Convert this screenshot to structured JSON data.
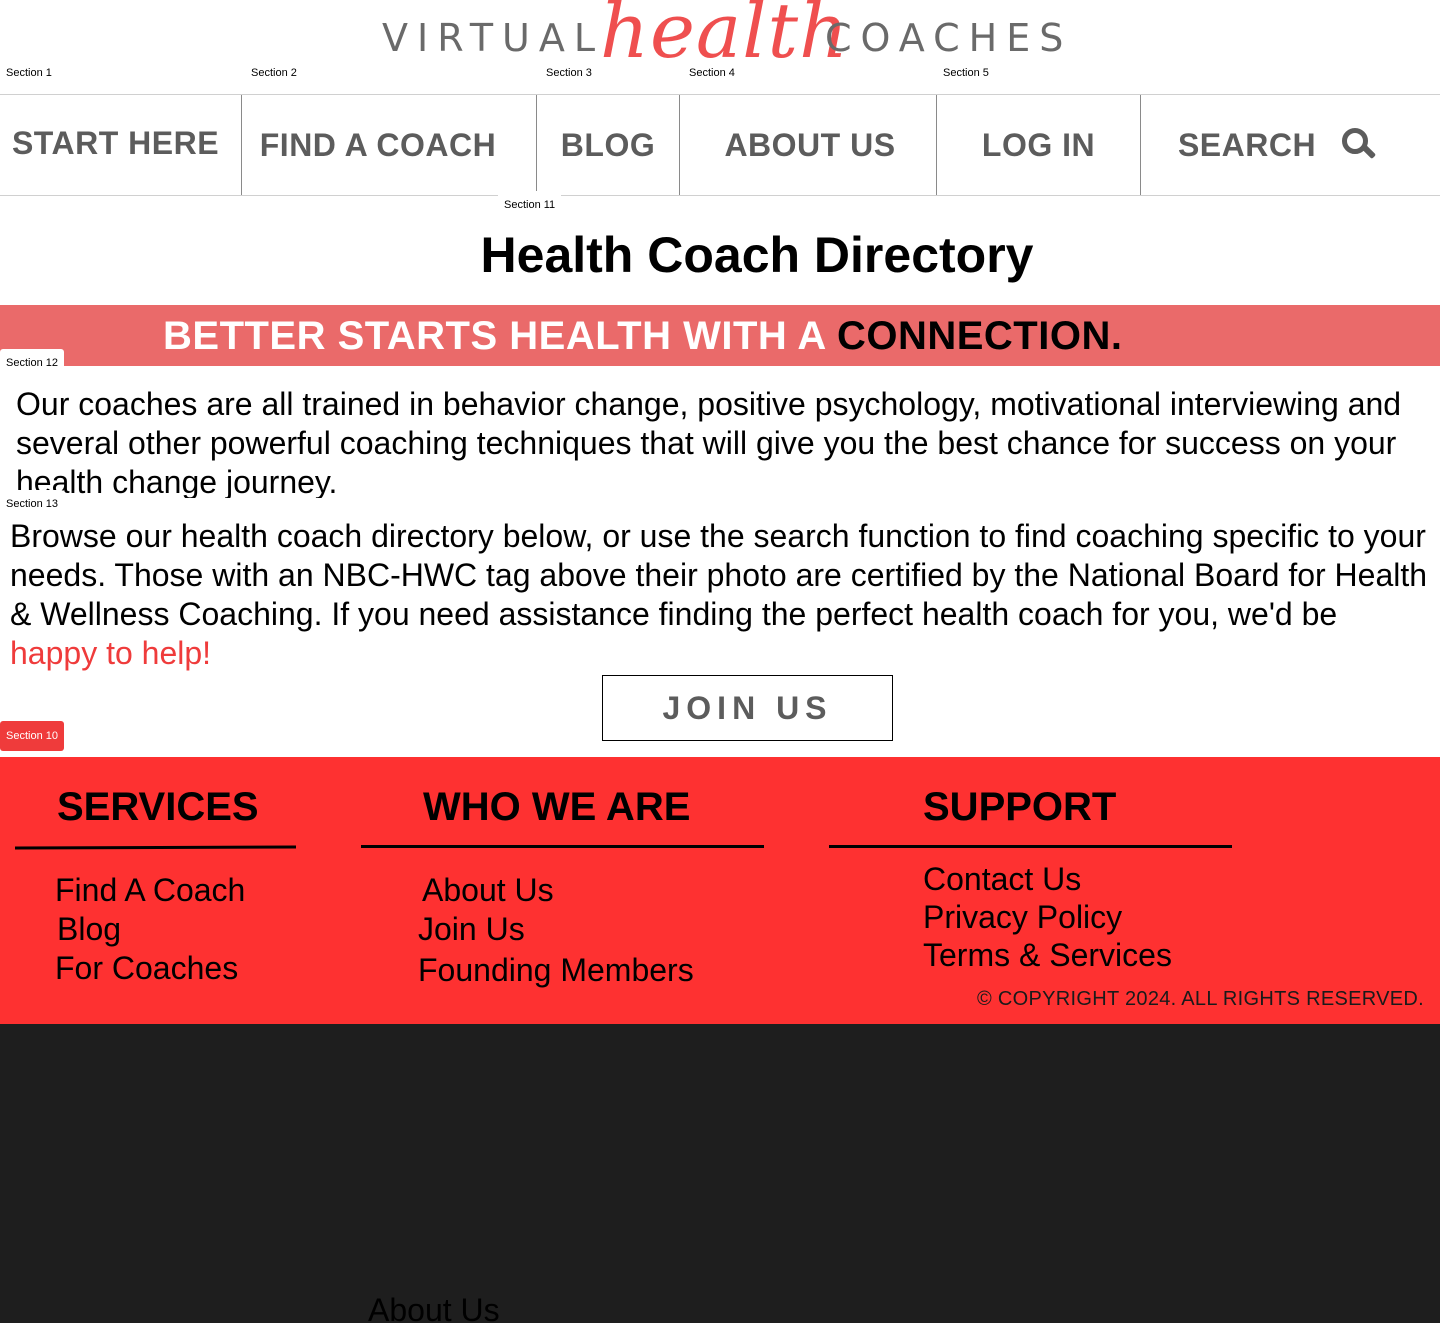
{
  "logo": {
    "left_word": "VIRTUAL",
    "script_word": "health",
    "right_word": "COACHES",
    "brand_color": "#ef4f4f"
  },
  "section_labels": {
    "s1": "Section 1",
    "s2": "Section 2",
    "s3": "Section 3",
    "s4": "Section 4",
    "s5": "Section 5",
    "s11": "Section 11",
    "s12": "Section 12",
    "s13": "Section 13",
    "s10": "Section 10"
  },
  "nav": {
    "start_here": "START HERE",
    "find_a_coach": "FIND  A COACH",
    "blog": "BLOG",
    "about_us": "ABOUT US",
    "log_in": "LOG IN",
    "search": "SEARCH",
    "search_icon": "search-icon"
  },
  "main": {
    "title": "Health Coach Directory",
    "banner_light": "BETTER STARTS HEALTH WITH A ",
    "banner_dark": "CONNECTION.",
    "banner_color": "#ea6a6a",
    "para1": "Our coaches are all trained in behavior change, positive psychology, motivational interviewing and several other powerful coaching techniques that will give you the best chance for success on your health change journey.",
    "para2": "Browse our health coach directory below, or use the search function to find coaching specific to your needs. Those with an NBC-HWC tag above their photo are certified by the National Board for Health & Wellness Coaching. If you need assistance finding the perfect health coach for you, we'd be ",
    "para2_link": "happy to help!",
    "join_button": "JOIN US"
  },
  "footer": {
    "bg_color": "#fe3131",
    "services": {
      "heading": "SERVICES",
      "links": [
        "Find A Coach",
        "Blog",
        "For Coaches"
      ]
    },
    "who_we_are": {
      "heading": "WHO WE ARE",
      "links": [
        "About Us",
        "Join Us",
        "Founding Members"
      ]
    },
    "support": {
      "heading": "SUPPORT",
      "links": [
        "Contact Us",
        "Privacy Policy",
        "Terms & Services"
      ]
    },
    "copyright": "© COPYRIGHT 2024. ALL RIGHTS RESERVED."
  },
  "lower": {
    "about_us": "About Us"
  }
}
